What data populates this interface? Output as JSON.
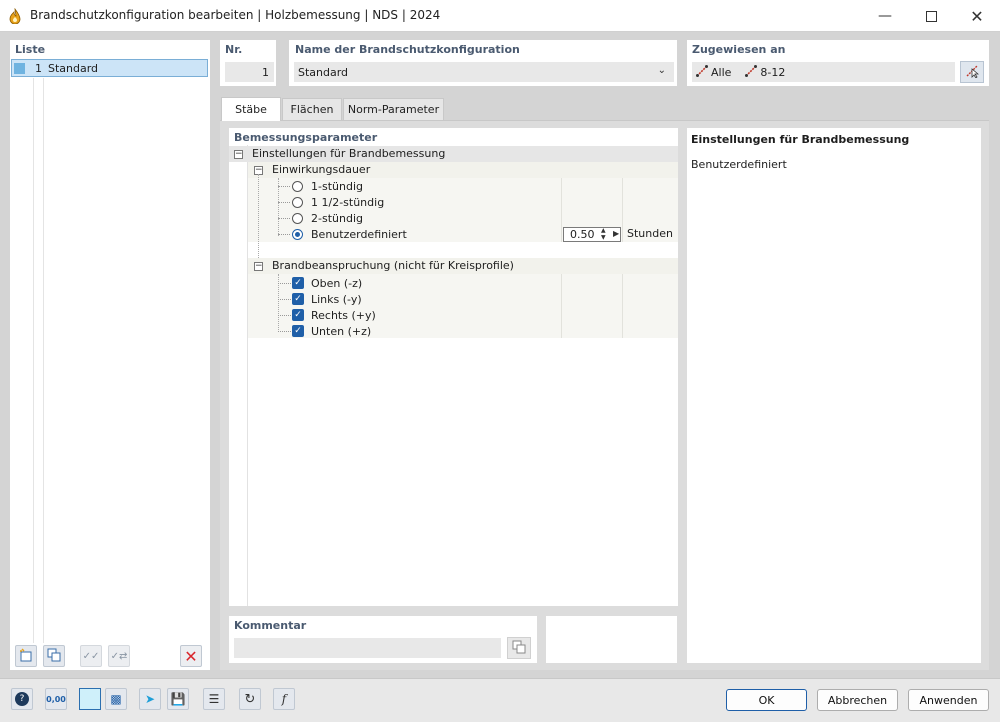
{
  "window": {
    "title": "Brandschutzkonfiguration bearbeiten | Holzbemessung | NDS | 2024"
  },
  "list": {
    "label": "Liste",
    "items": [
      {
        "number": "1",
        "name": "Standard"
      }
    ]
  },
  "header": {
    "nr_label": "Nr.",
    "nr_value": "1",
    "name_label": "Name der Brandschutzkonfiguration",
    "name_value": "Standard",
    "assigned_label": "Zugewiesen an",
    "assigned_all": "Alle",
    "assigned_members": "8-12"
  },
  "tabs": [
    {
      "label": "Stäbe",
      "active": true
    },
    {
      "label": "Flächen",
      "active": false
    },
    {
      "label": "Norm-Parameter",
      "active": false
    }
  ],
  "params": {
    "section_label": "Bemessungsparameter",
    "group_label": "Einstellungen für Brandbemessung",
    "duration": {
      "label": "Einwirkungsdauer",
      "options": [
        "1-stündig",
        "1 1/2-stündig",
        "2-stündig",
        "Benutzerdefiniert"
      ],
      "selected": "Benutzerdefiniert",
      "custom_value": "0.50",
      "custom_unit": "Stunden"
    },
    "exposure": {
      "label": "Brandbeanspruchung (nicht für Kreisprofile)",
      "sides": [
        {
          "label": "Oben (-z)",
          "checked": true
        },
        {
          "label": "Links (-y)",
          "checked": true
        },
        {
          "label": "Rechts (+y)",
          "checked": true
        },
        {
          "label": "Unten (+z)",
          "checked": true
        }
      ]
    }
  },
  "info": {
    "title": "Einstellungen für Brandbemessung",
    "text": "Benutzerdefiniert"
  },
  "comment": {
    "label": "Kommentar",
    "value": ""
  },
  "footer": {
    "numeric_icon_text": "0,00",
    "ok": "OK",
    "cancel": "Abbrechen",
    "apply": "Anwenden"
  },
  "colors": {
    "accent": "#1f5fa8",
    "selection": "#cce4f7",
    "label": "#4a5a70",
    "delete": "#d9262c"
  }
}
